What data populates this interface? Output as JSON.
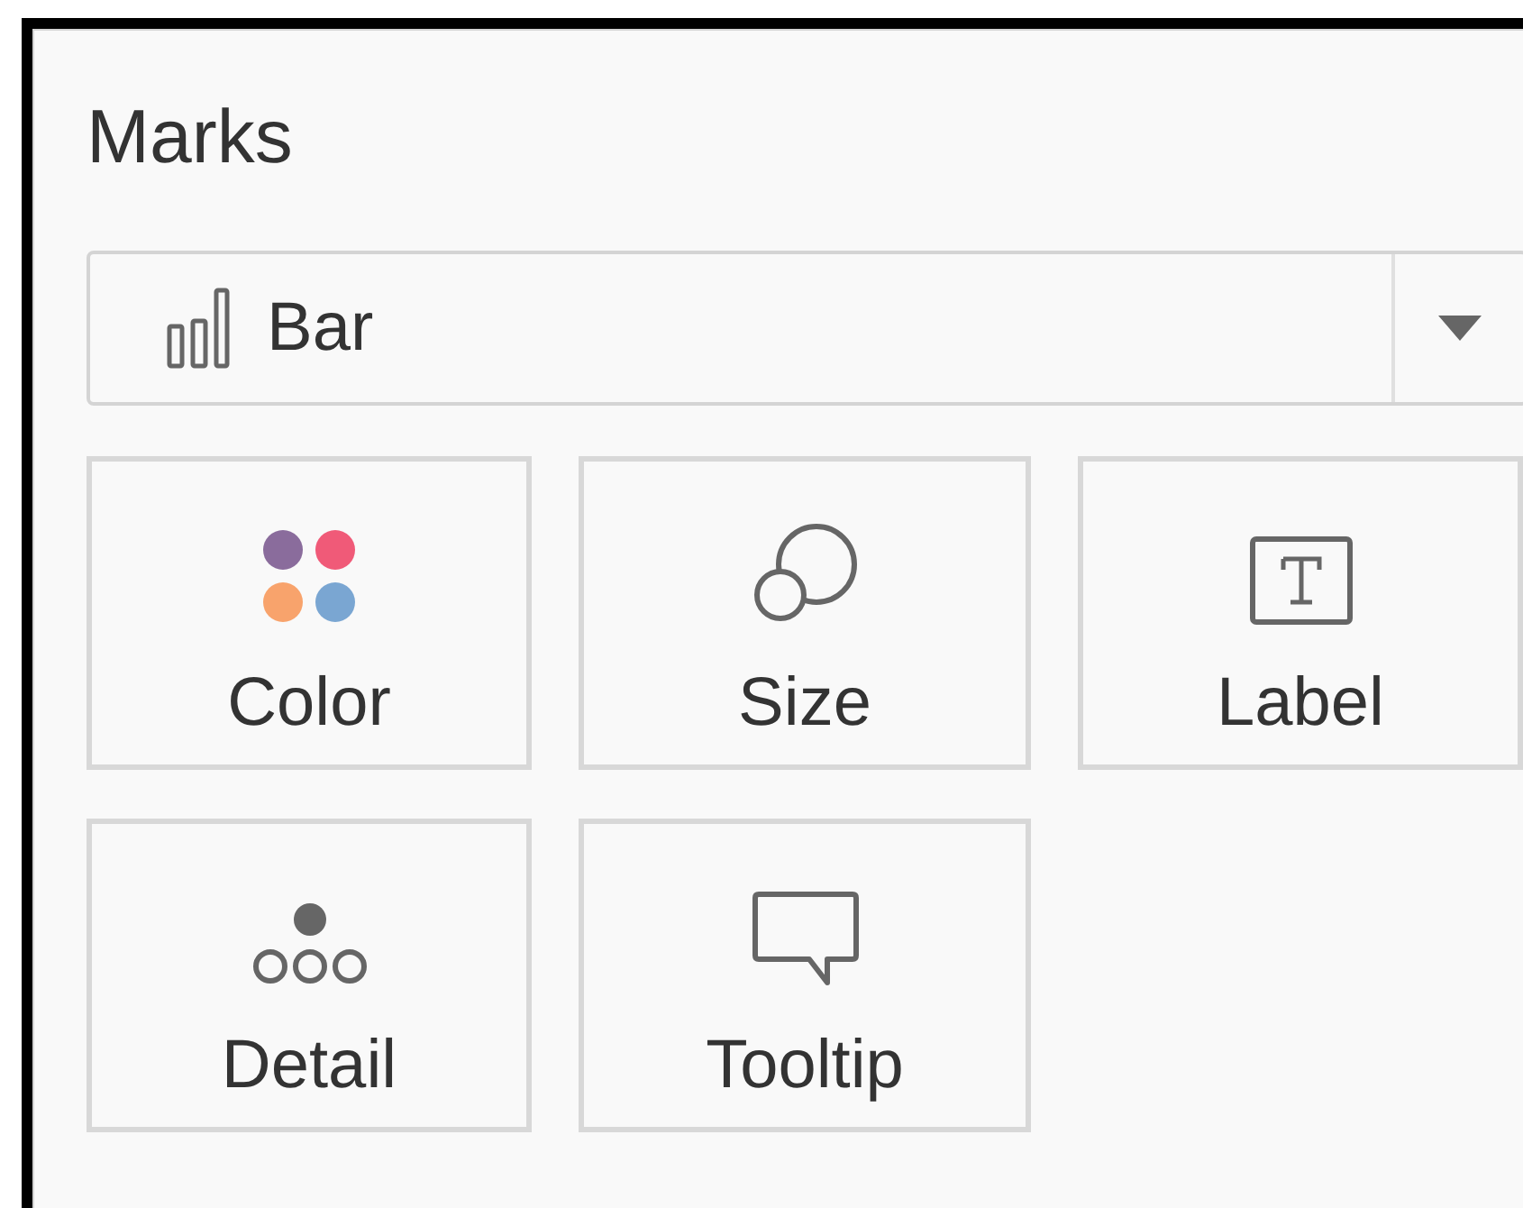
{
  "panel": {
    "title": "Marks"
  },
  "mark_type": {
    "kind": "bar",
    "value": "Bar"
  },
  "cards": [
    {
      "kind": "color",
      "label": "Color"
    },
    {
      "kind": "size",
      "label": "Size"
    },
    {
      "kind": "label",
      "label": "Label"
    },
    {
      "kind": "detail",
      "label": "Detail"
    },
    {
      "kind": "tooltip",
      "label": "Tooltip"
    }
  ]
}
